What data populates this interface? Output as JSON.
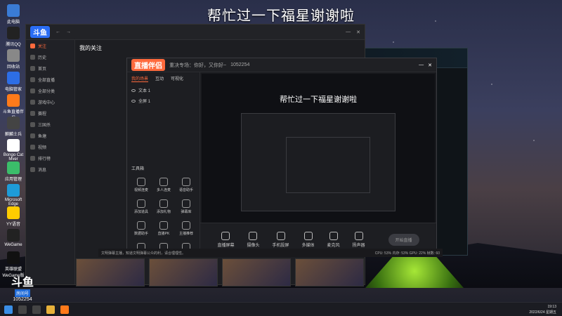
{
  "overlay_title": "帮忙过一下福星谢谢啦",
  "desktop_icons": [
    {
      "label": "此电脑",
      "color": "#3a7bd5"
    },
    {
      "label": "腾讯QQ",
      "color": "#222"
    },
    {
      "label": "回收站",
      "color": "#888"
    },
    {
      "label": "电脑管家",
      "color": "#2d6ee6"
    },
    {
      "label": "斗鱼直播伴侣",
      "color": "#ff7a1a"
    },
    {
      "label": "麒麟士兵",
      "color": "#444"
    },
    {
      "label": "Bongo Cat Mver",
      "color": "#fff"
    },
    {
      "label": "应用管理",
      "color": "#3bbd6a"
    },
    {
      "label": "Microsoft Edge",
      "color": "#1e9bd7"
    },
    {
      "label": "YY语音",
      "color": "#ffcc00"
    },
    {
      "label": "WeGame",
      "color": "#222"
    },
    {
      "label": "英雄联盟 WeGame版",
      "color": "#111"
    }
  ],
  "main_window": {
    "logo": "斗鱼",
    "sidebar": [
      {
        "label": "关注",
        "active": true
      },
      {
        "label": "历史"
      },
      {
        "label": "首页"
      },
      {
        "label": "全部直播"
      },
      {
        "label": "全部分类"
      },
      {
        "label": "游戏中心"
      },
      {
        "label": "赛程"
      },
      {
        "label": "三国杀"
      },
      {
        "label": "鱼塘"
      },
      {
        "label": "视频"
      },
      {
        "label": "排行榜"
      },
      {
        "label": "消息"
      }
    ],
    "section_title": "我的关注"
  },
  "companion": {
    "title": "直播伴侣",
    "topbar": {
      "direction_label": "重决专场：你好，又你好~",
      "room": "1052254"
    },
    "tabs": [
      {
        "label": "我的场景",
        "active": true
      },
      {
        "label": "互动"
      },
      {
        "label": "可视化"
      }
    ],
    "sources": [
      {
        "label": "文本 1"
      },
      {
        "label": "全屏 1"
      }
    ],
    "tools_label": "工具箱",
    "tools": [
      "视频连麦",
      "多人连麦",
      "语音助手",
      "添加道具",
      "添加礼物",
      "弹幕库",
      "数据助手",
      "直播PK",
      "主播推荐",
      "上麦一起玩",
      "玩法抽奖",
      "更多"
    ],
    "preview_title": "帮忙过一下福星谢谢啦",
    "bottom_tools": [
      "直播屏幕",
      "摄像头",
      "手机投屏",
      "多媒体",
      "麦克风",
      "扬声器"
    ],
    "start_button": "开始直播",
    "notice": "文明弹幕主播，知道文明弹幕公众的利，请合理理性。",
    "status": [
      "CPU: 53%",
      "内存: 53%",
      "GPU: 22%",
      "帧数: 60"
    ]
  },
  "room_badge": {
    "logo": "斗鱼",
    "tag": "房间号",
    "number": "1052254"
  },
  "taskbar": {
    "time": "19:13",
    "date": "2022/6/24 星期五"
  }
}
